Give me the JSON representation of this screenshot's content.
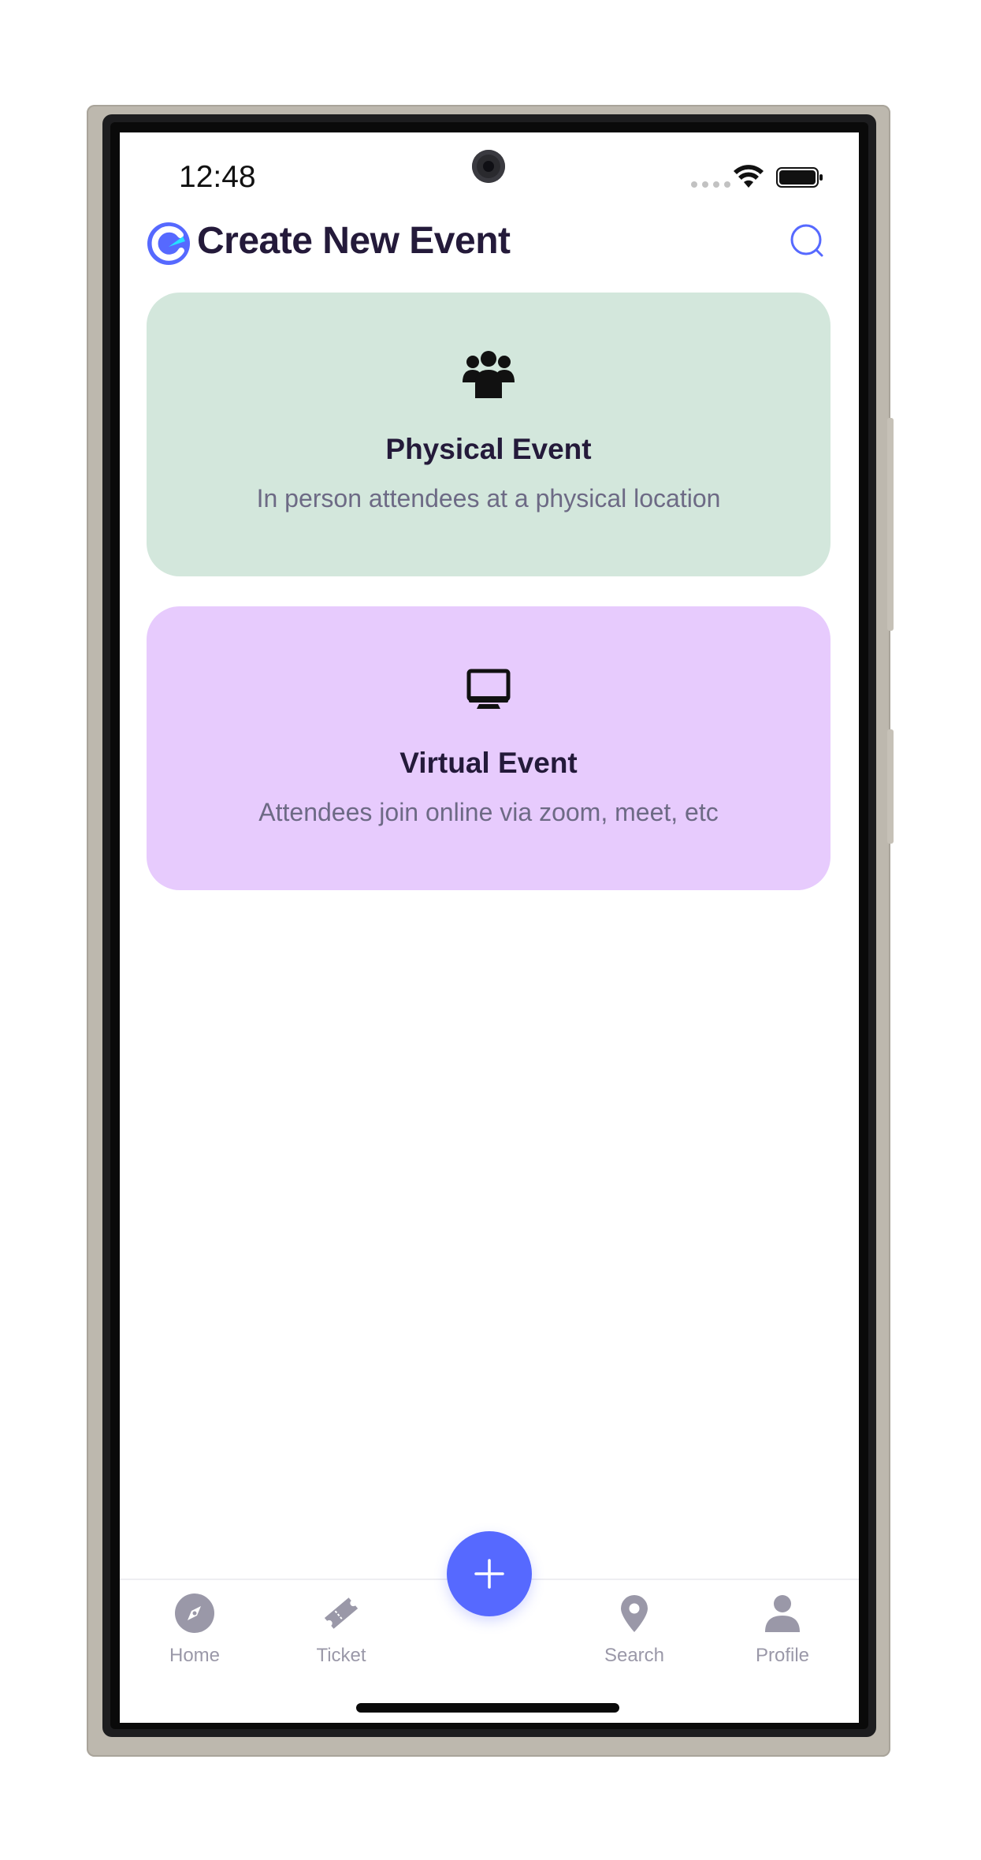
{
  "status_bar": {
    "time": "12:48"
  },
  "header": {
    "title": "Create New Event",
    "logo_icon": "app-logo-icon",
    "search_icon": "search-icon"
  },
  "cards": {
    "physical": {
      "icon": "group-users-icon",
      "title": "Physical Event",
      "description": "In person attendees at a physical location",
      "background": "#d3e7dc"
    },
    "virtual": {
      "icon": "monitor-icon",
      "title": "Virtual Event",
      "description": "Attendees join online via zoom, meet, etc",
      "background": "#e7cbfd"
    }
  },
  "bottom_nav": {
    "items": [
      {
        "id": "home",
        "label": "Home",
        "icon": "compass-icon"
      },
      {
        "id": "ticket",
        "label": "Ticket",
        "icon": "ticket-icon"
      },
      {
        "id": "search",
        "label": "Search",
        "icon": "location-pin-icon"
      },
      {
        "id": "profile",
        "label": "Profile",
        "icon": "user-icon"
      }
    ],
    "fab_icon": "plus-icon"
  },
  "colors": {
    "accent": "#5669ff",
    "title_text": "#241a3a",
    "secondary_text": "#6d6a85",
    "nav_inactive": "#9a98a8"
  }
}
